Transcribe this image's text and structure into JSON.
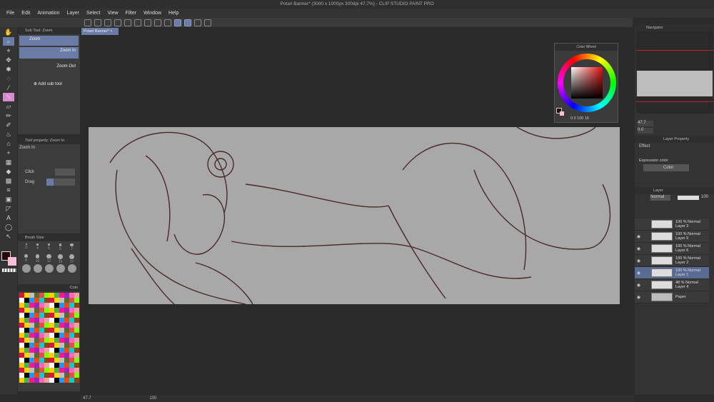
{
  "window": {
    "title": "Potari Banner* (3000 x 1000px 300dpi 47.7%) - CLIP STUDIO PAINT PRO"
  },
  "menu": [
    "File",
    "Edit",
    "Animation",
    "Layer",
    "Select",
    "View",
    "Filter",
    "Window",
    "Help"
  ],
  "subtool": {
    "title": "Sub Tool: Zoom",
    "group": "Zoom",
    "items": [
      "Zoom In",
      "Zoom Out"
    ],
    "add_label": "Add sub tool"
  },
  "tool_property": {
    "title": "Tool property: Zoom In",
    "name": "Zoom In",
    "click_label": "Click",
    "drag_label": "Drag"
  },
  "brush_size": {
    "title": "Brush Size",
    "sizes": [
      "3",
      "4",
      "5",
      "6",
      "7",
      "8",
      "10",
      "12",
      "15",
      "17"
    ]
  },
  "palette": {
    "title": "Colo"
  },
  "document_tab": {
    "label": "Potari Banner*"
  },
  "color_wheel": {
    "title": "Color Wheel",
    "values": "0  0 100  16"
  },
  "colors": {
    "main": "#2a0508",
    "sub": "#f7bfd9",
    "accent": "#6a7ca6"
  },
  "navigator": {
    "title": "Navigator",
    "zoom": "47.7",
    "angle": "0.0"
  },
  "layer_property": {
    "title": "Layer Property",
    "effect_label": "Effect",
    "expression_label": "Expression color",
    "expression_value": "Color"
  },
  "layers": {
    "title": "Layer",
    "blend": "Normal",
    "opacity": "100",
    "items": [
      {
        "mode": "100 % Normal",
        "name": "Layer 3",
        "visible": false,
        "selected": false
      },
      {
        "mode": "100 % Normal",
        "name": "Layer 5",
        "visible": true,
        "selected": false
      },
      {
        "mode": "100 % Normal",
        "name": "Layer 6",
        "visible": true,
        "selected": false
      },
      {
        "mode": "100 % Normal",
        "name": "Layer 2",
        "visible": true,
        "selected": false
      },
      {
        "mode": "100 % Normal",
        "name": "Layer 1",
        "visible": true,
        "selected": true
      },
      {
        "mode": "48 % Normal",
        "name": "Layer 4",
        "visible": true,
        "selected": false
      },
      {
        "mode": "",
        "name": "Paper",
        "visible": true,
        "selected": false
      }
    ]
  },
  "status": {
    "zoom": "47.7",
    "value": "100"
  }
}
